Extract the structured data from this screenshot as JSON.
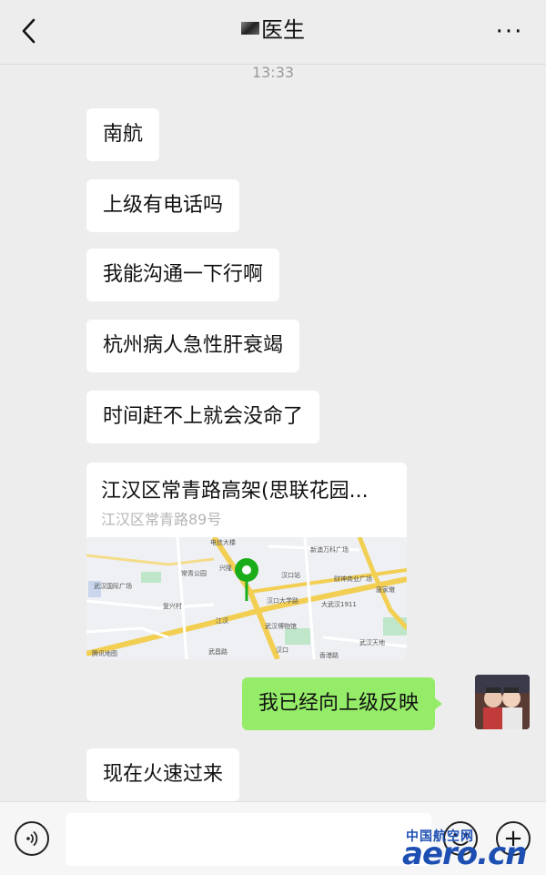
{
  "header": {
    "title": "医生",
    "back_icon": "chevron-left-icon",
    "more_label": "···"
  },
  "chat": {
    "timestamp": "13:33",
    "messages": [
      {
        "side": "in",
        "text": "南航"
      },
      {
        "side": "in",
        "text": "上级有电话吗"
      },
      {
        "side": "in",
        "text": "我能沟通一下行啊"
      },
      {
        "side": "in",
        "text": "杭州病人急性肝衰竭"
      },
      {
        "side": "in",
        "text": "时间赶不上就会没命了"
      },
      {
        "side": "in",
        "type": "location",
        "title": "江汉区常青路高架(思联花园...",
        "address": "江汉区常青路89号"
      },
      {
        "side": "out",
        "text": "我已经向上级反映"
      },
      {
        "side": "in",
        "text": "现在火速过来"
      }
    ]
  },
  "map": {
    "labels": [
      "电信大楼",
      "新澳万科广场",
      "常青公园",
      "兴隆",
      "汉口站",
      "财神商业广场",
      "汉口大学路",
      "大武汉1911",
      "唐家墩",
      "武汉国际广场",
      "复兴村",
      "武汉博物馆",
      "武汉天地",
      "腾讯地图",
      "江汉",
      "武昌路",
      "汉口",
      "香港路"
    ],
    "attribution": "腾讯地图"
  },
  "composer": {
    "voice_icon": "voice-icon",
    "input_placeholder": "",
    "emoji_icon": "emoji-icon",
    "plus_label": "+"
  },
  "watermark": {
    "cn": "中国航空网",
    "en": "aero.cn"
  },
  "colors": {
    "background": "#ededed",
    "bubble_in": "#ffffff",
    "bubble_out": "#95ec69",
    "pin": "#1aad19",
    "watermark": "#1d4fb3"
  }
}
